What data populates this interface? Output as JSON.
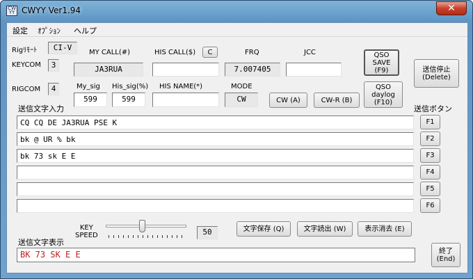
{
  "window": {
    "title": "CWYY Ver1.94",
    "icon_text": "CW\nYY",
    "close": "✕"
  },
  "menu": [
    "設定",
    "ｵﾌﾟｼｮﾝ",
    "ヘルプ"
  ],
  "rig": {
    "remote_label": "Rigﾘﾓｰﾄ",
    "remote_value": "CI-V",
    "keycom_label": "KEYCOM",
    "keycom_value": "3",
    "rigcom_label": "RIGCOM",
    "rigcom_value": "4"
  },
  "headers": {
    "mycall": "MY CALL(#)",
    "hiscall": "HIS CALL($)",
    "clear_btn": "C",
    "frq": "FRQ",
    "jcc": "JCC",
    "mysig": "My_sig",
    "hissig": "His_sig(%)",
    "hisname": "HIS NAME(*)",
    "mode": "MODE"
  },
  "values": {
    "mycall": "JA3RUA",
    "hiscall": "",
    "frq": "7.007405",
    "jcc": "",
    "mysig": "599",
    "hissig": "599",
    "hisname": "",
    "mode": "CW"
  },
  "buttons": {
    "qso_save": "QSO\nSAVE\n(F9)",
    "qso_daylog": "QSO\ndaylog\n(F10)",
    "stop": "送信停止\n(Delete)",
    "cw": "CW (A)",
    "cwr": "CW-R (B)",
    "save_text": "文字保存 (Q)",
    "load_text": "文字読出 (W)",
    "clear_display": "表示消去 (E)",
    "exit": "終了\n(End)"
  },
  "labels": {
    "send_input": "送信文字入力",
    "send_buttons": "送信ボタン",
    "key_speed": "KEY\nSPEED",
    "send_display": "送信文字表示"
  },
  "messages": [
    "CQ CQ DE JA3RUA PSE K",
    "bk @ UR % bk",
    "bk 73 sk E E",
    "",
    "",
    ""
  ],
  "fkeys": [
    "F1",
    "F2",
    "F3",
    "F4",
    "F5",
    "F6"
  ],
  "speed": {
    "value": "50",
    "level": 0.45
  },
  "status_text": "BK 73 SK E E"
}
